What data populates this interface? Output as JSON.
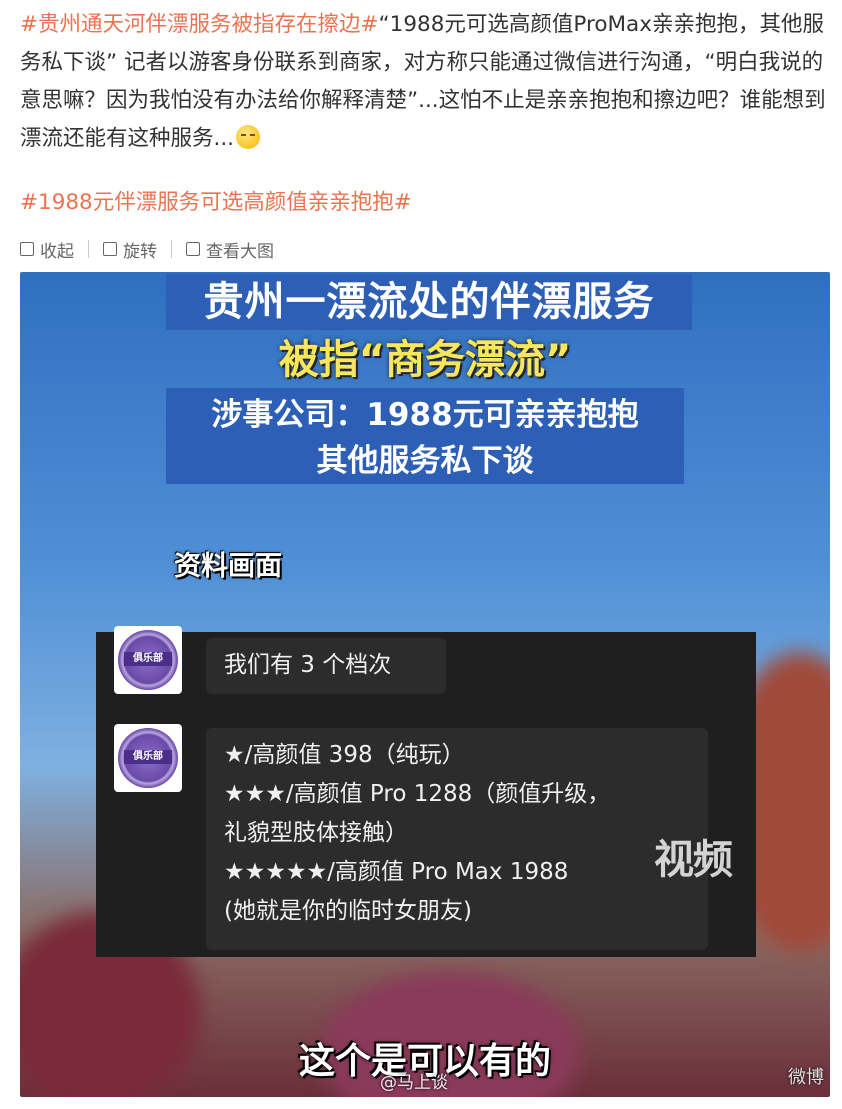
{
  "post": {
    "hashtag_main": "#贵州通天河伴漂服务被指存在擦边#",
    "body": "“1988元可选高颜值ProMax亲亲抱抱，其他服务私下谈” 记者以游客身份联系到商家，对方称只能通过微信进行沟通，“明白我说的意思嘛？因为我怕没有办法给你解释清楚”...这怕不止是亲亲抱抱和擦边吧？谁能想到漂流还能有这种服务...",
    "emoji_icon": "sleepy-face-emoji",
    "hashtag_second": "#1988元伴漂服务可选高颜值亲亲抱抱#"
  },
  "toolbar": {
    "collapse": "收起",
    "rotate": "旋转",
    "view_large": "查看大图"
  },
  "image": {
    "banner_line1": "贵州一漂流处的伴漂服务",
    "banner_line2": "被指“商务漂流”",
    "banner_line3a": "涉事公司：1988元可亲亲抱抱",
    "banner_line3b": "其他服务私下谈",
    "archive_label": "资料画面",
    "avatar_label": "俱乐部",
    "msg1": "我们有 3 个档次",
    "tier1": "★/高颜值 398（纯玩）",
    "tier2a": "★★★/高颜值 Pro 1288（颜值升级，",
    "tier2b": "礼貌型肢体接触）",
    "tier3a": "★★★★★/高颜值 Pro Max 1988",
    "tier3b": "(她就是你的临时女朋友)",
    "watermark": "视频",
    "subtitle": "这个是可以有的",
    "source": "@马上谈",
    "corner_mark": "微博"
  },
  "colors": {
    "hashtag": "#eb7350",
    "banner_blue": "#2c5fb5",
    "banner_yellow": "#f6e85a"
  }
}
